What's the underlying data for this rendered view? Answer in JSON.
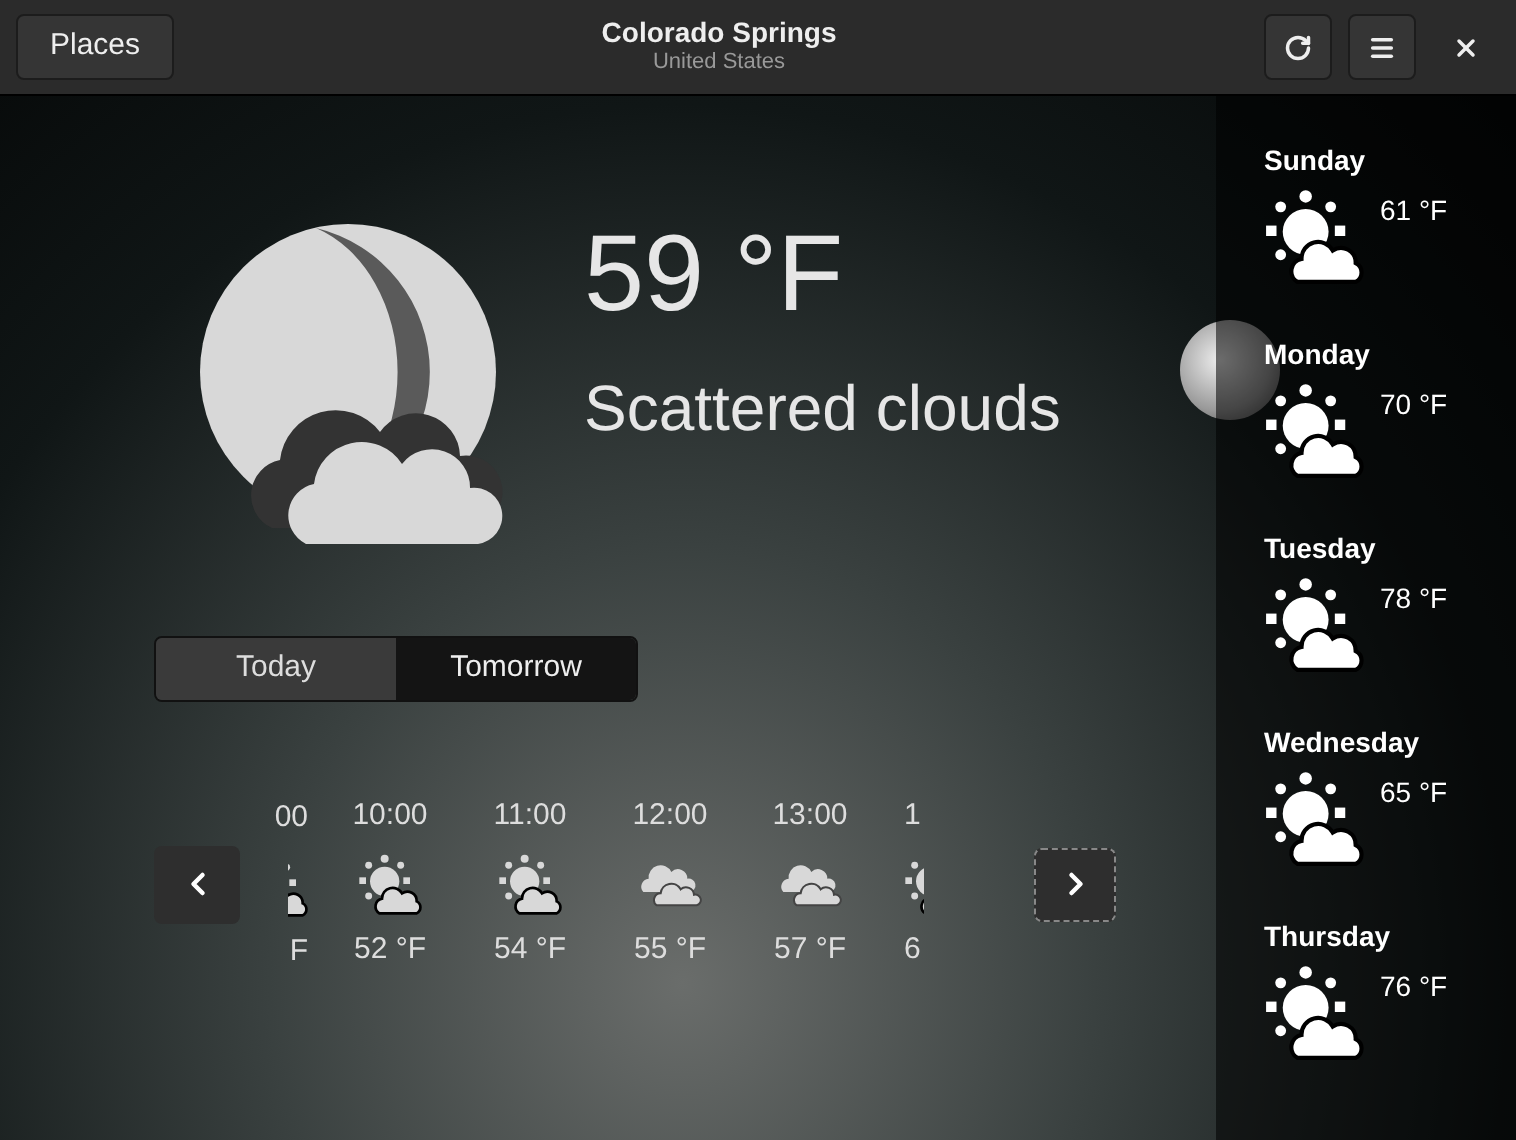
{
  "header": {
    "places_button": "Places",
    "title": "Colorado Springs",
    "subtitle": "United States"
  },
  "current": {
    "kind": "night-cloud",
    "temperature": "59 °F",
    "summary": "Scattered clouds"
  },
  "tabs": [
    {
      "label": "Today",
      "selected": true
    },
    {
      "label": "Tomorrow",
      "selected": false
    }
  ],
  "hourly": [
    {
      "time": "00",
      "temperature": "F",
      "kind": "sun-cloud"
    },
    {
      "time": "10:00",
      "temperature": "52 °F",
      "kind": "sun-cloud"
    },
    {
      "time": "11:00",
      "temperature": "54 °F",
      "kind": "sun-cloud"
    },
    {
      "time": "12:00",
      "temperature": "55 °F",
      "kind": "cloud"
    },
    {
      "time": "13:00",
      "temperature": "57 °F",
      "kind": "cloud"
    },
    {
      "time": "1",
      "temperature": "6",
      "kind": "sun-cloud"
    }
  ],
  "daily": [
    {
      "day": "Sunday",
      "temperature": "61 °F",
      "kind": "sun-cloud"
    },
    {
      "day": "Monday",
      "temperature": "70 °F",
      "kind": "sun-cloud"
    },
    {
      "day": "Tuesday",
      "temperature": "78 °F",
      "kind": "sun-cloud"
    },
    {
      "day": "Wednesday",
      "temperature": "65 °F",
      "kind": "sun-cloud"
    },
    {
      "day": "Thursday",
      "temperature": "76 °F",
      "kind": "sun-cloud"
    }
  ]
}
